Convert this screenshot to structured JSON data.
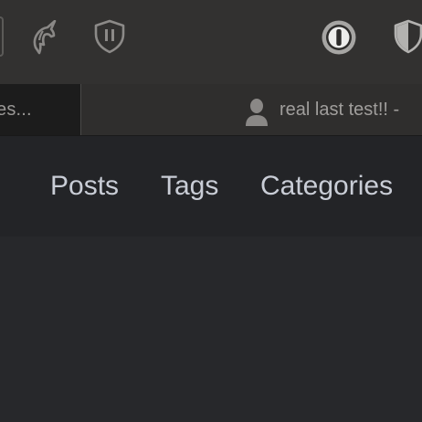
{
  "browser": {
    "toolbar": {
      "extensions": [
        {
          "name": "unicorn-icon"
        },
        {
          "name": "pause-shield-icon"
        },
        {
          "name": "password-manager-icon"
        },
        {
          "name": "shield-icon"
        }
      ]
    },
    "tabs": [
      {
        "label": "es...",
        "active": true
      },
      {
        "label": "real last test!! -",
        "active": false,
        "icon": "user-avatar-icon"
      }
    ]
  },
  "site": {
    "nav": {
      "items": [
        {
          "label": "Posts"
        },
        {
          "label": "Tags"
        },
        {
          "label": "Categories"
        }
      ]
    }
  },
  "colors": {
    "toolbar_bg": "#323130",
    "tab_active_bg": "#1c1c1c",
    "nav_bg": "#232427",
    "page_bg": "#27282b",
    "nav_text": "#c9cdd6"
  }
}
